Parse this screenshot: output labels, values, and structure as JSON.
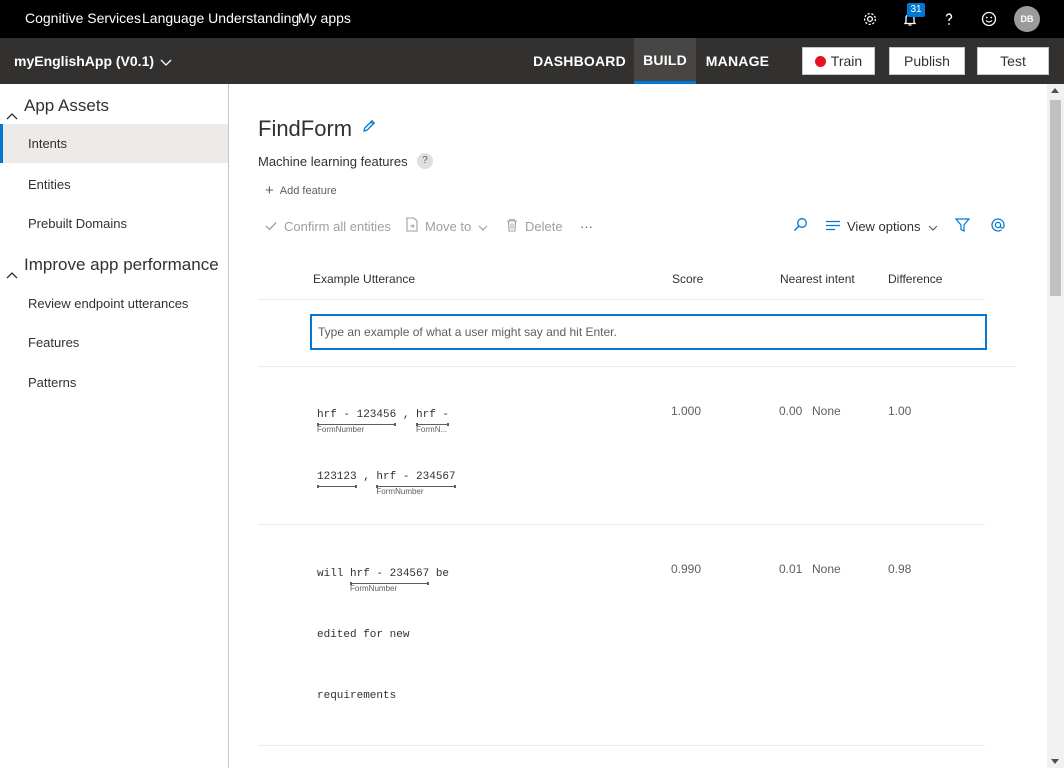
{
  "topnav": {
    "links": [
      "Cognitive Services",
      "Language Understanding",
      "My apps"
    ],
    "notification_count": "31",
    "avatar_initials": "DB",
    "icons": [
      "gear-icon",
      "bell-icon",
      "help-icon",
      "smiley-icon"
    ]
  },
  "appbar": {
    "app_name": "myEnglishApp (V0.1)",
    "tabs": [
      {
        "label": "DASHBOARD",
        "active": false
      },
      {
        "label": "BUILD",
        "active": true
      },
      {
        "label": "MANAGE",
        "active": false
      }
    ],
    "train_label": "Train",
    "publish_label": "Publish",
    "test_label": "Test",
    "train_status_color": "#e81123"
  },
  "sidebar": {
    "groups": [
      {
        "label": "App Assets",
        "items": [
          "Intents",
          "Entities",
          "Prebuilt Domains"
        ]
      },
      {
        "label": "Improve app performance",
        "items": [
          "Review endpoint utterances",
          "Features",
          "Patterns"
        ]
      }
    ],
    "active_item": "Intents"
  },
  "main": {
    "title": "FindForm",
    "ml_features_title": "Machine learning features",
    "help_glyph": "?",
    "add_feature_label": "Add feature",
    "toolbar": {
      "confirm_all": "Confirm all entities",
      "move_to": "Move to",
      "delete": "Delete",
      "more": "···",
      "view_options": "View options"
    },
    "columns": [
      "Example Utterance",
      "Score",
      "Nearest intent",
      "Difference"
    ],
    "input_placeholder": "Type an example of what a user might say and hit Enter.",
    "rows": [
      {
        "lines": [
          [
            {
              "text": "hrf - 123456",
              "entity": "FormNumber"
            },
            {
              "text": " , "
            },
            {
              "text": "hrf -",
              "entity": "FormN..."
            }
          ],
          [
            {
              "text": "123123",
              "entity": ""
            },
            {
              "text": " , "
            },
            {
              "text": "hrf - 234567",
              "entity": "FormNumber"
            }
          ]
        ],
        "score": "1.000",
        "nearest_score": "0.00",
        "nearest_intent": "None",
        "difference": "1.00"
      },
      {
        "lines": [
          [
            {
              "text": "will "
            },
            {
              "text": "hrf - 234567",
              "entity": "FormNumber"
            },
            {
              "text": " be"
            }
          ],
          [
            {
              "text": "edited for new"
            }
          ],
          [
            {
              "text": "requirements"
            }
          ]
        ],
        "score": "0.990",
        "nearest_score": "0.01",
        "nearest_intent": "None",
        "difference": "0.98"
      }
    ]
  },
  "colors": {
    "accent": "#0078d4",
    "topbar": "#000000",
    "appbar": "#323130"
  }
}
